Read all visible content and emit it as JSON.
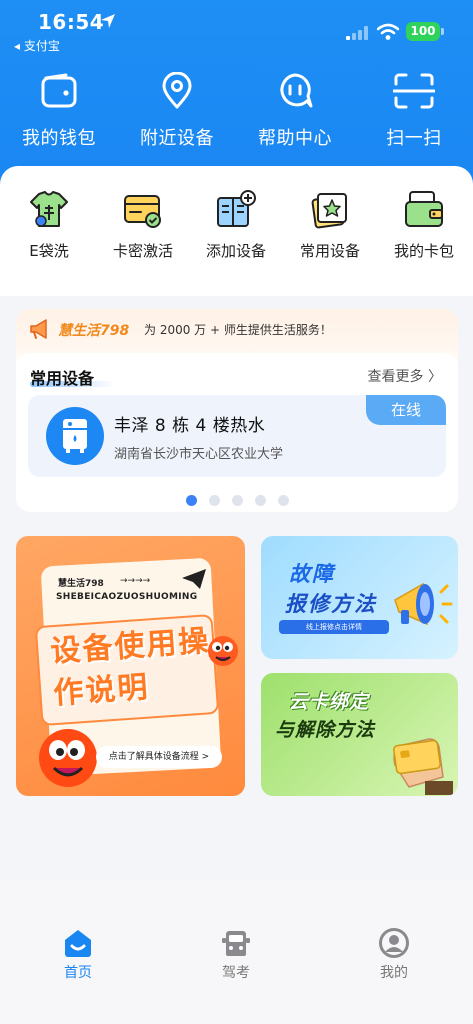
{
  "status_bar": {
    "time": "16:54",
    "back_app": "◂ 支付宝",
    "battery": "100"
  },
  "quick_actions": [
    {
      "label": "我的钱包",
      "icon": "wallet-icon"
    },
    {
      "label": "附近设备",
      "icon": "location-pin-icon"
    },
    {
      "label": "帮助中心",
      "icon": "chat-help-icon"
    },
    {
      "label": "扫一扫",
      "icon": "scan-icon"
    }
  ],
  "services": [
    {
      "label": "E袋洗",
      "icon": "laundry-shirt-icon"
    },
    {
      "label": "卡密激活",
      "icon": "card-activate-icon"
    },
    {
      "label": "添加设备",
      "icon": "add-device-icon"
    },
    {
      "label": "常用设备",
      "icon": "favorite-device-icon"
    },
    {
      "label": "我的卡包",
      "icon": "card-wallet-icon"
    }
  ],
  "promo": {
    "brand": "慧生活798",
    "text": "为 2000 万 + 师生提供生活服务！"
  },
  "frequent": {
    "title": "常用设备",
    "see_more": "查看更多",
    "device": {
      "name": "丰泽 8 栋 4 楼热水",
      "address": "湖南省长沙市天心区农业大学",
      "status": "在线",
      "icon": "water-heater-icon"
    },
    "pages": 5,
    "active_page": 1
  },
  "banners": {
    "manual": {
      "brand": "慧生活798",
      "arrows": "→→→→",
      "subtitle": "SHEBEICAOZUOSHUOMING",
      "title": "设备使用操作说明",
      "button": "点击了解具体设备流程 >"
    },
    "repair": {
      "line1": "故障",
      "line2": "报修方法",
      "sub": "线上报修点击详情"
    },
    "card": {
      "line1": "云卡绑定",
      "line2": "与解除方法"
    }
  },
  "tabs": [
    {
      "label": "首页",
      "icon": "home-icon",
      "active": true
    },
    {
      "label": "驾考",
      "icon": "car-icon",
      "active": false
    },
    {
      "label": "我的",
      "icon": "profile-icon",
      "active": false
    }
  ],
  "colors": {
    "primary": "#1a86f2",
    "online": "#5aaaf5",
    "brand_orange": "#f08a1c",
    "battery_green": "#2fd25b"
  }
}
